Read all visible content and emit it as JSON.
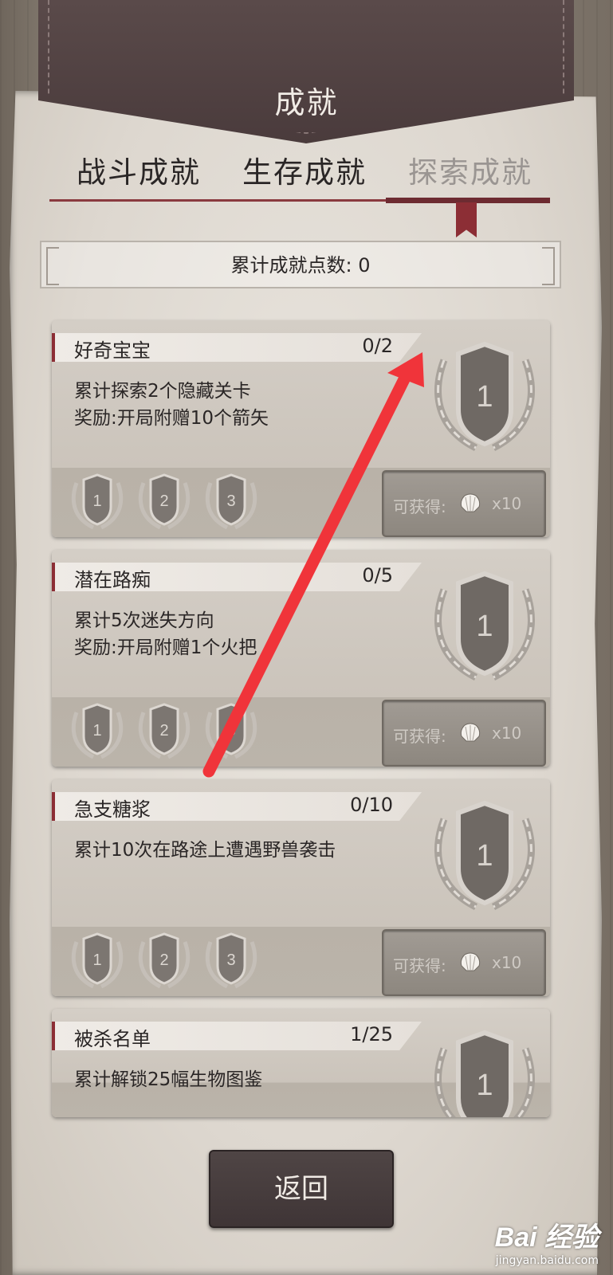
{
  "header": {
    "title": "成就"
  },
  "tabs": [
    {
      "label": "战斗成就",
      "active": false
    },
    {
      "label": "生存成就",
      "active": false
    },
    {
      "label": "探索成就",
      "active": true
    }
  ],
  "points": {
    "label": "累计成就点数: 0"
  },
  "achievements": [
    {
      "name": "好奇宝宝",
      "progress": "0/2",
      "desc": [
        "累计探索2个隐藏关卡",
        "奖励:开局附赠10个箭矢"
      ],
      "big_medal": "1",
      "medals": [
        "1",
        "2",
        "3"
      ],
      "reward": {
        "label": "可获得:",
        "icon": "shell-icon",
        "qty": "x10"
      }
    },
    {
      "name": "潜在路痴",
      "progress": "0/5",
      "desc": [
        "累计5次迷失方向",
        "奖励:开局附赠1个火把"
      ],
      "big_medal": "1",
      "medals": [
        "1",
        "2",
        "3"
      ],
      "reward": {
        "label": "可获得:",
        "icon": "shell-icon",
        "qty": "x10"
      }
    },
    {
      "name": "急支糖浆",
      "progress": "0/10",
      "desc": [
        "累计10次在路途上遭遇野兽袭击"
      ],
      "big_medal": "1",
      "medals": [
        "1",
        "2",
        "3"
      ],
      "reward": {
        "label": "可获得:",
        "icon": "shell-icon",
        "qty": "x10"
      }
    },
    {
      "name": "被杀名单",
      "progress": "1/25",
      "desc": [
        "累计解锁25幅生物图鉴"
      ],
      "big_medal": "1"
    }
  ],
  "footer": {
    "back_label": "返回"
  },
  "watermark": {
    "brand": "Bai 经验",
    "sub": "jingyan.baidu.com"
  },
  "colors": {
    "accent": "#8c2e35",
    "banner": "#4e3f40",
    "arrow": "#f0343a"
  }
}
